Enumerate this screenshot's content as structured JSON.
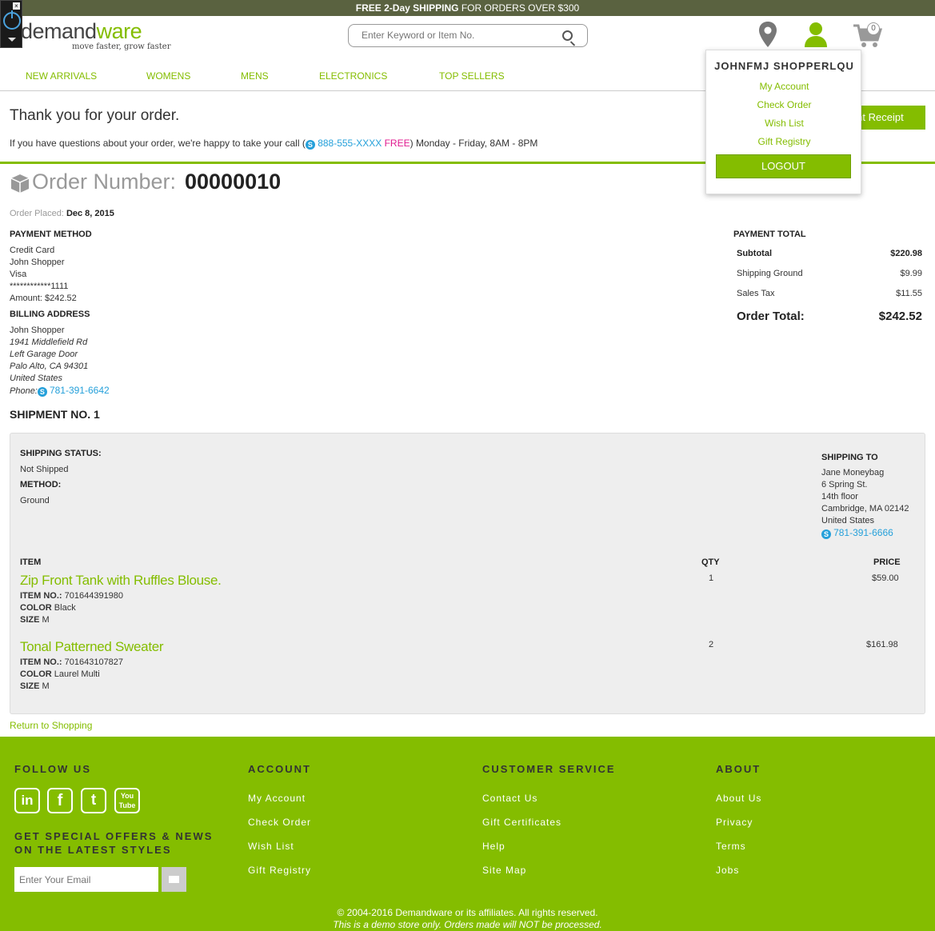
{
  "promo": {
    "bold": "FREE 2-Day SHIPPING",
    "rest": " FOR ORDERS OVER $300"
  },
  "logo": {
    "name_a": "demand",
    "name_b": "ware",
    "tagline": "move faster, grow faster"
  },
  "search": {
    "placeholder": "Enter Keyword or Item No."
  },
  "cart": {
    "count": "0"
  },
  "nav": [
    "NEW ARRIVALS",
    "WOMENS",
    "MENS",
    "ELECTRONICS",
    "TOP SELLERS"
  ],
  "thanks": {
    "title": "Thank you for your order.",
    "pre": "If you have questions about your order, we're happy to take your call (",
    "phone": "888-555-XXXX",
    "free": "FREE",
    "post": ") Monday - Friday, 8AM - 8PM"
  },
  "print_receipt": "Print Receipt",
  "order": {
    "label": "Order Number:",
    "number": "00000010",
    "placed_label": "Order Placed:",
    "placed_date": "Dec 8, 2015"
  },
  "payment_method": {
    "heading": "PAYMENT METHOD",
    "lines": [
      "Credit Card",
      "John Shopper",
      "Visa",
      "************1111",
      "Amount: $242.52"
    ]
  },
  "billing": {
    "heading": "BILLING ADDRESS",
    "name": "John Shopper",
    "addr": [
      "1941 Middlefield Rd",
      "Left Garage Door",
      "Palo Alto, CA 94301",
      "United States"
    ],
    "phone_label": "Phone:",
    "phone": "781-391-6642"
  },
  "payment_total": {
    "heading": "PAYMENT TOTAL",
    "subtotal_label": "Subtotal",
    "subtotal": "$220.98",
    "shipping_label": "Shipping Ground",
    "shipping": "$9.99",
    "tax_label": "Sales Tax",
    "tax": "$11.55",
    "total_label": "Order Total:",
    "total": "$242.52"
  },
  "shipment": {
    "title": "SHIPMENT NO. 1",
    "status_label": "SHIPPING STATUS:",
    "status": "Not Shipped",
    "method_label": "METHOD:",
    "method": "Ground",
    "to_label": "SHIPPING TO",
    "to_lines": [
      "Jane Moneybag",
      "6 Spring St.",
      "14th floor",
      "Cambridge, MA 02142",
      "United States"
    ],
    "to_phone": "781-391-6666",
    "col_item": "ITEM",
    "col_qty": "QTY",
    "col_price": "PRICE",
    "items": [
      {
        "name": "Zip Front Tank with Ruffles Blouse.",
        "item_no": "701644391980",
        "color": "Black",
        "size": "M",
        "qty": "1",
        "price": "$59.00"
      },
      {
        "name": "Tonal Patterned Sweater",
        "item_no": "701643107827",
        "color": "Laurel Multi",
        "size": "M",
        "qty": "2",
        "price": "$161.98"
      }
    ],
    "item_no_label": "ITEM NO.:",
    "color_label": "COLOR",
    "size_label": "SIZE"
  },
  "return_link": "Return to Shopping",
  "footer": {
    "follow": "FOLLOW US",
    "account": "ACCOUNT",
    "service": "CUSTOMER SERVICE",
    "about": "ABOUT",
    "social": [
      "in",
      "f",
      "t",
      "You Tube"
    ],
    "offers_1": "GET SPECIAL OFFERS & NEWS",
    "offers_2": "ON THE LATEST STYLES",
    "email_placeholder": "Enter Your Email",
    "account_links": [
      "My Account",
      "Check Order",
      "Wish List",
      "Gift Registry"
    ],
    "service_links": [
      "Contact Us",
      "Gift Certificates",
      "Help",
      "Site Map"
    ],
    "about_links": [
      "About Us",
      "Privacy",
      "Terms",
      "Jobs"
    ],
    "copyright": "© 2004-2016 Demandware or its affiliates. All rights reserved.",
    "demo": "This is a demo store only. Orders made will NOT be processed."
  },
  "dropdown": {
    "user": "JOHNFMJ SHOPPERLQU",
    "links": [
      "My Account",
      "Check Order",
      "Wish List",
      "Gift Registry"
    ],
    "logout": "LOGOUT"
  },
  "colors": {
    "accent": "#84bd00",
    "link_blue": "#25a0da",
    "free_pink": "#e0198f"
  }
}
